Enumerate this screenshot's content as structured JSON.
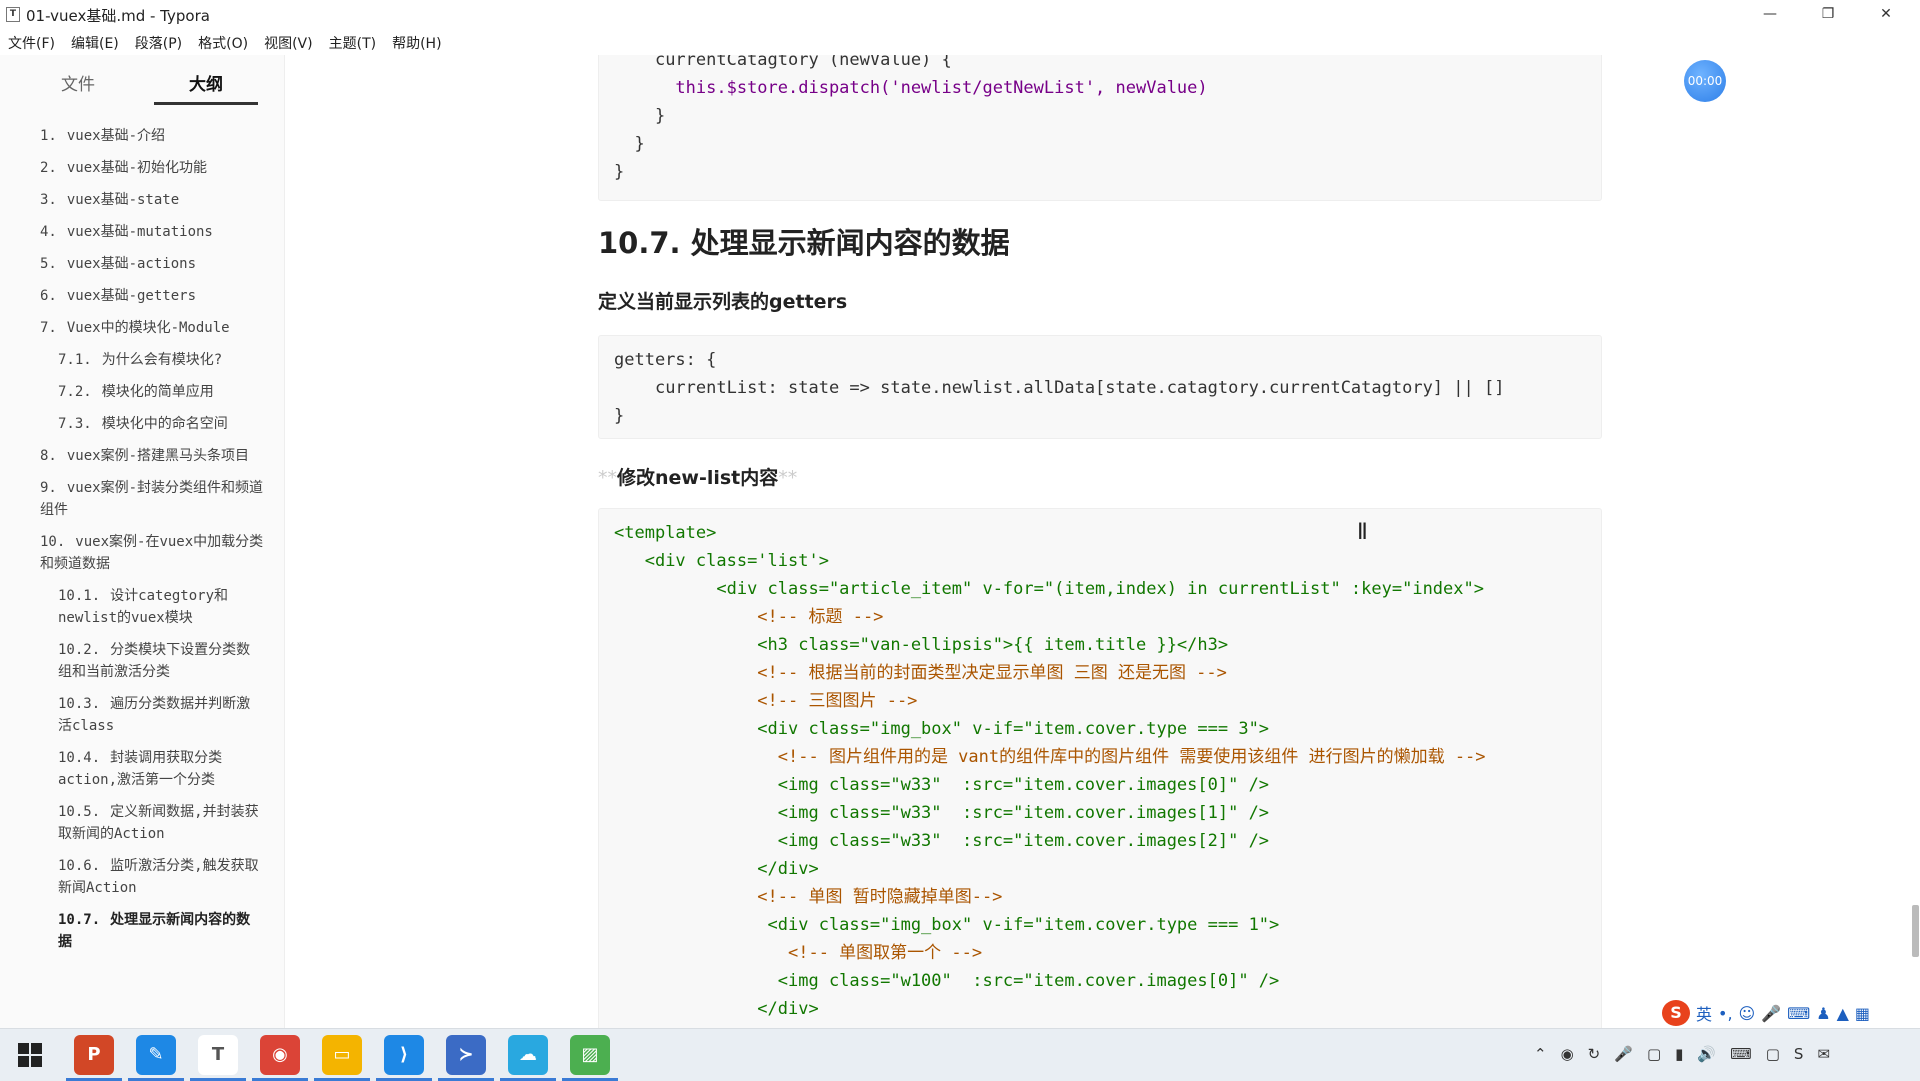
{
  "window": {
    "title": "01-vuex基础.md - Typora",
    "app_icon": "T"
  },
  "menu": [
    "文件(F)",
    "编辑(E)",
    "段落(P)",
    "格式(O)",
    "视图(V)",
    "主题(T)",
    "帮助(H)"
  ],
  "sidebar": {
    "tabs": [
      "文件",
      "大纲"
    ],
    "active_tab": "大纲",
    "items": [
      {
        "num": "1.",
        "label": "vuex基础-介绍"
      },
      {
        "num": "2.",
        "label": "vuex基础-初始化功能"
      },
      {
        "num": "3.",
        "label": "vuex基础-state"
      },
      {
        "num": "4.",
        "label": "vuex基础-mutations"
      },
      {
        "num": "5.",
        "label": "vuex基础-actions"
      },
      {
        "num": "6.",
        "label": "vuex基础-getters"
      },
      {
        "num": "7.",
        "label": "Vuex中的模块化-Module"
      },
      {
        "num": "7.1.",
        "label": "为什么会有模块化?"
      },
      {
        "num": "7.2.",
        "label": "模块化的简单应用"
      },
      {
        "num": "7.3.",
        "label": "模块化中的命名空间"
      },
      {
        "num": "8.",
        "label": "vuex案例-搭建黑马头条项目"
      },
      {
        "num": "9.",
        "label": "vuex案例-封装分类组件和频道组件"
      },
      {
        "num": "10.",
        "label": "vuex案例-在vuex中加载分类和频道数据"
      },
      {
        "num": "10.1.",
        "label": "设计categtory和newlist的vuex模块"
      },
      {
        "num": "10.2.",
        "label": "分类模块下设置分类数组和当前激活分类"
      },
      {
        "num": "10.3.",
        "label": "遍历分类数据并判断激活class"
      },
      {
        "num": "10.4.",
        "label": "封装调用获取分类action,激活第一个分类"
      },
      {
        "num": "10.5.",
        "label": "定义新闻数据,并封装获取新闻的Action"
      },
      {
        "num": "10.6.",
        "label": "监听激活分类,触发获取新闻Action"
      },
      {
        "num": "10.7.",
        "label": "处理显示新闻内容的数据"
      }
    ],
    "footer": [
      "<",
      "</>"
    ]
  },
  "editor": {
    "heading": "10.7. 处理显示新闻内容的数据",
    "sub1": "定义当前显示列表的getters",
    "sub2_prefix": "**",
    "sub2": "修改new-list内容",
    "sub2_suffix": "**",
    "timer": "00:00",
    "code_top": [
      "currentCatagtory (newValue) {",
      "this.$store.dispatch('newlist/getNewList', newValue)",
      "}",
      "}",
      "}"
    ],
    "code_getters": [
      "getters: {",
      "currentList: state => state.newlist.allData[state.catagtory.currentCatagtory] || []",
      "}"
    ],
    "code_template": [
      "<template>",
      "<div class='list'>",
      "<div class=\"article_item\" v-for=\"(item,index) in currentList\" :key=\"index\">",
      "<!-- 标题 -->",
      "<h3 class=\"van-ellipsis\">{{ item.title }}</h3>",
      "<!-- 根据当前的封面类型决定显示单图 三图 还是无图 -->",
      "<!-- 三图图片 -->",
      "<div class=\"img_box\" v-if=\"item.cover.type === 3\">",
      "<!-- 图片组件用的是 vant的组件库中的图片组件 需要使用该组件 进行图片的懒加载 -->",
      "<img class=\"w33\"  :src=\"item.cover.images[0]\" />",
      "<img class=\"w33\"  :src=\"item.cover.images[1]\" />",
      "<img class=\"w33\"  :src=\"item.cover.images[2]\" />",
      "</div>",
      "<!-- 单图 暂时隐藏掉单图-->",
      "<div class=\"img_box\" v-if=\"item.cover.type === 1\">",
      "<!-- 单图取第一个 -->",
      "<img class=\"w100\"  :src=\"item.cover.images[0]\" />",
      "</div>"
    ]
  },
  "ime": {
    "logo": "S",
    "mode": "英"
  },
  "taskbar": {
    "apps": [
      {
        "name": "powerpoint-icon",
        "glyph": "P",
        "color": "#d24726"
      },
      {
        "name": "feather-app-icon",
        "glyph": "✎",
        "color": "#1e88e5"
      },
      {
        "name": "typora-icon",
        "glyph": "T",
        "color": "#555555"
      },
      {
        "name": "chrome-icon",
        "glyph": "◉",
        "color": "#db4437"
      },
      {
        "name": "file-explorer-icon",
        "glyph": "▭",
        "color": "#f4b400"
      },
      {
        "name": "vscode-icon",
        "glyph": "⟩",
        "color": "#1e88e5"
      },
      {
        "name": "powershell-icon",
        "glyph": "≻",
        "color": "#3b6bc5"
      },
      {
        "name": "cloud-app-icon",
        "glyph": "☁",
        "color": "#29a8e0"
      },
      {
        "name": "image-app-icon",
        "glyph": "▨",
        "color": "#4caf50"
      }
    ]
  }
}
